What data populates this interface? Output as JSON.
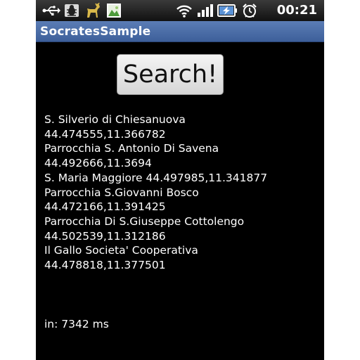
{
  "status_bar": {
    "icons": [
      "usb-icon",
      "debug-bug-icon",
      "deer-notification-icon",
      "image-notification-icon",
      "wifi-icon",
      "signal-icon",
      "battery-charging-icon",
      "alarm-clock-icon"
    ],
    "time": "00:21"
  },
  "app": {
    "title": "SocratesSample"
  },
  "search_button": {
    "label": "Search!"
  },
  "results": {
    "lines": [
      "S. Silverio di Chiesanuova",
      "44.474555,11.366782",
      "Parrocchia S. Antonio Di Savena",
      "44.492666,11.3694",
      "S. Maria Maggiore 44.497985,11.341877",
      "Parrocchia S.Giovanni Bosco",
      "44.472166,11.391425",
      "Parrocchia Di S.Giuseppe Cottolengo",
      "44.502539,11.312186",
      "Il Gallo Societa' Cooperativa",
      "44.478818,11.377501"
    ]
  },
  "timing": {
    "text": "in: 7342 ms"
  },
  "colors": {
    "title_bar": "#4a6ca8",
    "background": "#000000",
    "text": "#ffffff"
  }
}
